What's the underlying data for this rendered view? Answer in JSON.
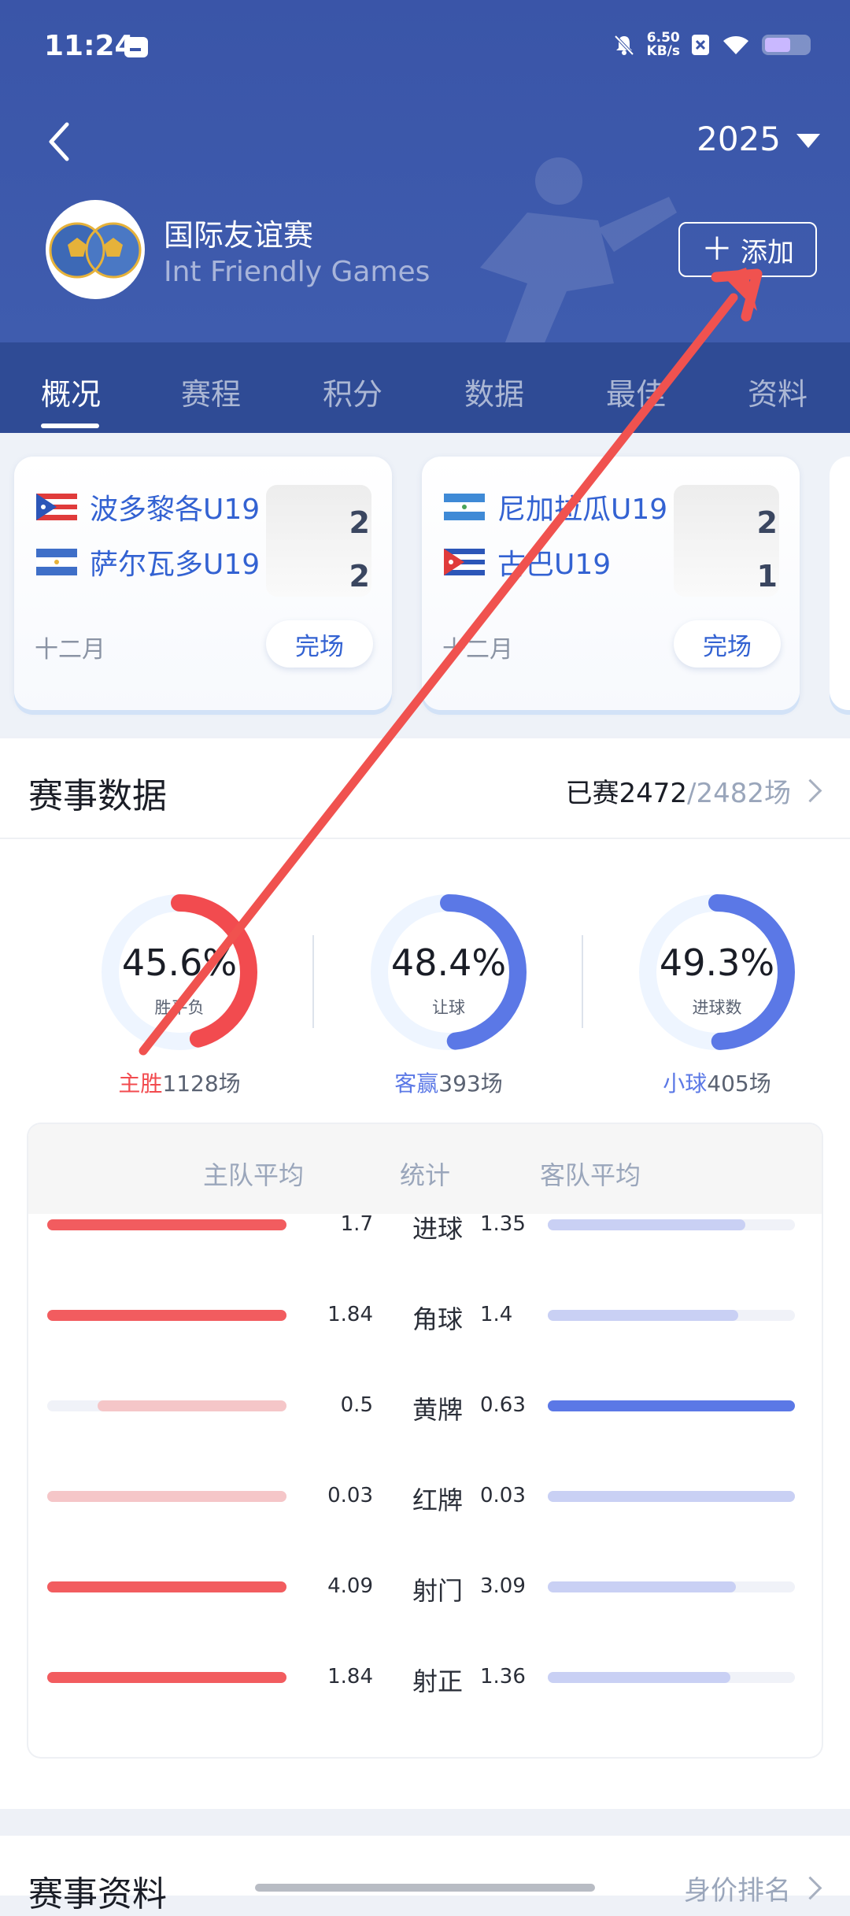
{
  "status_bar": {
    "time": "11:24",
    "net_speed_value": "6.50",
    "net_speed_unit": "KB/s"
  },
  "header": {
    "year": "2025",
    "league_name": "国际友谊赛",
    "league_en": "Int Friendly Games",
    "add_label": "添加"
  },
  "tabs": [
    "概况",
    "赛程",
    "积分",
    "数据",
    "最佳",
    "资料"
  ],
  "matches": [
    {
      "home": "波多黎各U19",
      "home_score": "2",
      "away": "萨尔瓦多U19",
      "away_score": "2",
      "month": "十二月",
      "status": "完场"
    },
    {
      "home": "尼加拉瓜U19",
      "home_score": "2",
      "away": "古巴U19",
      "away_score": "1",
      "month": "十二月",
      "status": "完场"
    }
  ],
  "event_data": {
    "title": "赛事数据",
    "played_label": "已赛2472",
    "total_label": "/2482场",
    "gauges": [
      {
        "percent": "45.6%",
        "fraction": 0.456,
        "label": "胜平负",
        "cap_key": "主胜",
        "cap_value": "1128场",
        "color": "#f24b4f"
      },
      {
        "percent": "48.4%",
        "fraction": 0.484,
        "label": "让球",
        "cap_key": "客赢",
        "cap_value": "393场",
        "color": "#5b78e6"
      },
      {
        "percent": "49.3%",
        "fraction": 0.493,
        "label": "进球数",
        "cap_key": "小球",
        "cap_value": "405场",
        "color": "#5b78e6"
      }
    ],
    "table": {
      "headers": {
        "home": "主队平均",
        "stat": "统计",
        "away": "客队平均"
      },
      "rows": [
        {
          "stat": "进球",
          "home": "1.7",
          "away": "1.35",
          "home_frac": 1.0,
          "away_frac": 0.8,
          "home_strong": true,
          "away_strong": false
        },
        {
          "stat": "角球",
          "home": "1.84",
          "away": "1.4",
          "home_frac": 1.0,
          "away_frac": 0.77,
          "home_strong": true,
          "away_strong": false
        },
        {
          "stat": "黄牌",
          "home": "0.5",
          "away": "0.63",
          "home_frac": 0.79,
          "away_frac": 1.0,
          "home_strong": false,
          "away_strong": true
        },
        {
          "stat": "红牌",
          "home": "0.03",
          "away": "0.03",
          "home_frac": 1.0,
          "away_frac": 1.0,
          "home_strong": false,
          "away_strong": false
        },
        {
          "stat": "射门",
          "home": "4.09",
          "away": "3.09",
          "home_frac": 1.0,
          "away_frac": 0.76,
          "home_strong": true,
          "away_strong": false
        },
        {
          "stat": "射正",
          "home": "1.84",
          "away": "1.36",
          "home_frac": 1.0,
          "away_frac": 0.74,
          "home_strong": true,
          "away_strong": false
        }
      ]
    }
  },
  "bottom": {
    "title": "赛事资料",
    "right": "身价排名"
  },
  "colors": {
    "header_bg": "#3a55a8",
    "tabs_bg": "#2f4b95",
    "accent_blue": "#3362d2",
    "home_red": "#f25c5f",
    "home_red_light": "#f5c6c8",
    "away_blue": "#5b78e6",
    "away_blue_light": "#c9d0f4",
    "annotation_arrow": "#f0524f"
  }
}
